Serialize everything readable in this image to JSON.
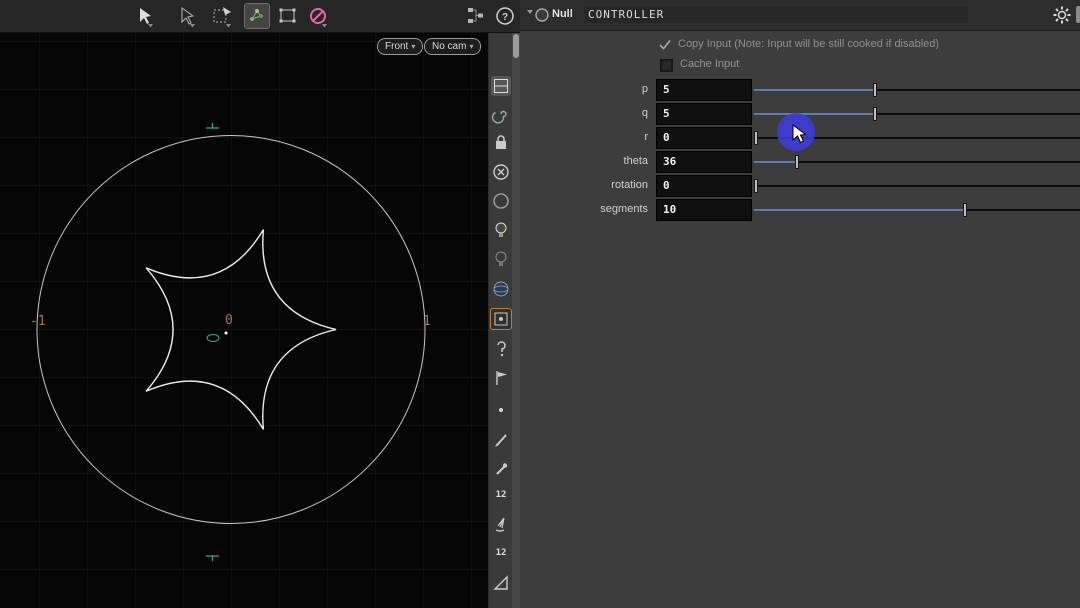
{
  "colors": {
    "accent_blue": "#5b7db1",
    "cursor_blue": "#3e3ce4",
    "selection_orange": "#c87a2e",
    "axis_label_orange": "#b0764a",
    "marker_teal": "#3aa9a0",
    "panel_bg": "#3d3d3d",
    "viewport_bg": "#060606"
  },
  "top_toolbar": {
    "icons": [
      "cursor-tool",
      "select-tool",
      "transform-tool",
      "handles-tool",
      "marquee-tool",
      "no-selection-tool",
      "network-tree",
      "help"
    ],
    "help_glyph": "?"
  },
  "viewport": {
    "view_button": "Front",
    "view_button_arrow": "▾",
    "camera_button": "No cam",
    "camera_button_arrow": "▾",
    "axis_labels": {
      "minus_one": "-1",
      "zero": "0",
      "one": "1"
    }
  },
  "side_toolbar": {
    "icons": [
      "view-layout",
      "construction-plane",
      "lock",
      "delete-view",
      "circle",
      "light",
      "light-alt",
      "shaded-view",
      "view-state",
      "hook",
      "flag",
      "dot",
      "brush",
      "dropper",
      "point-numbers",
      "broom",
      "point-numbers-alt",
      "ruler"
    ],
    "point_number_badge": "12"
  },
  "panel": {
    "node_type": "Null",
    "node_name": "CONTROLLER",
    "copy_input_label": "Copy Input (Note: Input will be still cooked if disabled)",
    "cache_input_label": "Cache Input",
    "params": [
      {
        "name": "p",
        "value": "5",
        "fraction": 0.376
      },
      {
        "name": "q",
        "value": "5",
        "fraction": 0.376
      },
      {
        "name": "r",
        "value": "0",
        "fraction": 0.0
      },
      {
        "name": "theta",
        "value": "36",
        "fraction": 0.133
      },
      {
        "name": "rotation",
        "value": "0",
        "fraction": 0.0
      },
      {
        "name": "segments",
        "value": "10",
        "fraction": 0.655
      }
    ]
  }
}
